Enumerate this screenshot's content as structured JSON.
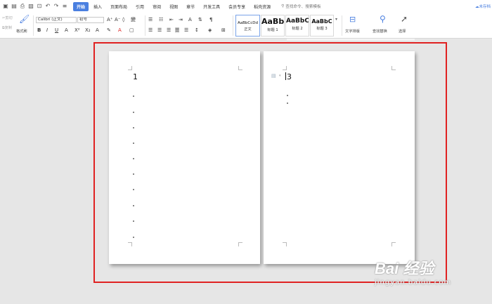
{
  "tabs": [
    "开始",
    "插入",
    "页面布局",
    "引用",
    "审阅",
    "视图",
    "章节",
    "开发工具",
    "会员专享",
    "稻壳资源"
  ],
  "search_text": "查找命令、搜索模板",
  "status_right": "未存档",
  "clipboard": {
    "cut": "剪切",
    "copy": "复制",
    "format_painter": "格式刷"
  },
  "font": {
    "name": "Calibri (正文)",
    "size": "初号"
  },
  "styles": [
    {
      "sample": "AaBbCcDd",
      "name": "正文"
    },
    {
      "sample": "AaBb",
      "name": "标题 1"
    },
    {
      "sample": "AaBbC",
      "name": "标题 2"
    },
    {
      "sample": "AaBbC",
      "name": "标题 3"
    }
  ],
  "text_layout": "文字排版",
  "find_replace": "查找替换",
  "select": "选择",
  "pages": {
    "left_number": "1",
    "right_number": "3"
  },
  "watermark": {
    "line1": "Bai  经验",
    "line2": "jingyan.baidu.com"
  }
}
